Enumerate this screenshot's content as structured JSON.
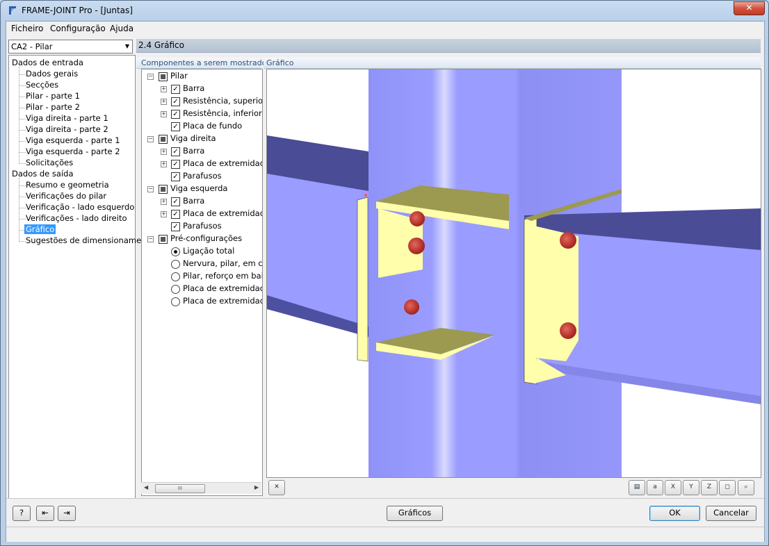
{
  "window": {
    "title": "FRAME-JOINT Pro - [Juntas]",
    "close_glyph": "✕"
  },
  "menu": [
    "Ficheiro",
    "Configuração",
    "Ajuda"
  ],
  "case_select": {
    "value": "CA2 - Pilar"
  },
  "nav": {
    "input_header": "Dados de entrada",
    "input_items": [
      "Dados gerais",
      "Secções",
      "Pilar - parte 1",
      "Pilar - parte 2",
      "Viga direita - parte 1",
      "Viga direita - parte 2",
      "Viga esquerda - parte 1",
      "Viga esquerda - parte 2",
      "Solicitações"
    ],
    "output_header": "Dados de saída",
    "output_items": [
      "Resumo e geometria",
      "Verificações do pilar",
      "Verificação - lado esquerdo",
      "Verificações - lado direito",
      "Gráfico",
      "Sugestões de dimensionamento"
    ],
    "selected": "Gráfico"
  },
  "section_title": "2.4 Gráfico",
  "components_header": "Componentes a serem mostrados",
  "graphic_header": "Gráfico",
  "components": {
    "groups": [
      {
        "label": "Pilar",
        "items": [
          "Barra",
          "Resistência, superior",
          "Resistência, inferior",
          "Placa de fundo"
        ]
      },
      {
        "label": "Viga direita",
        "items": [
          "Barra",
          "Placa de extremidade",
          "Parafusos"
        ]
      },
      {
        "label": "Viga esquerda",
        "items": [
          "Barra",
          "Placa de extremidade",
          "Parafusos"
        ]
      }
    ],
    "presets_label": "Pré-configurações",
    "presets": [
      "Ligação total",
      "Nervura, pilar, em cim",
      "Pilar, reforço em baixo",
      "Placa de extremidade",
      "Placa de extremidade"
    ],
    "selected_preset": "Ligação total",
    "scroll_thumb": "III"
  },
  "buttons": {
    "graphics": "Gráficos",
    "ok": "OK",
    "cancel": "Cancelar"
  },
  "icons": {
    "help": "help-icon",
    "import": "import-icon",
    "export": "export-icon"
  },
  "colors": {
    "column": "#9a9cff",
    "beam_top": "#4a4c96",
    "plate": "#fffeaa",
    "plate_top": "#9b9a50",
    "bolt": "#c0302a",
    "selection": "#3399ff"
  }
}
